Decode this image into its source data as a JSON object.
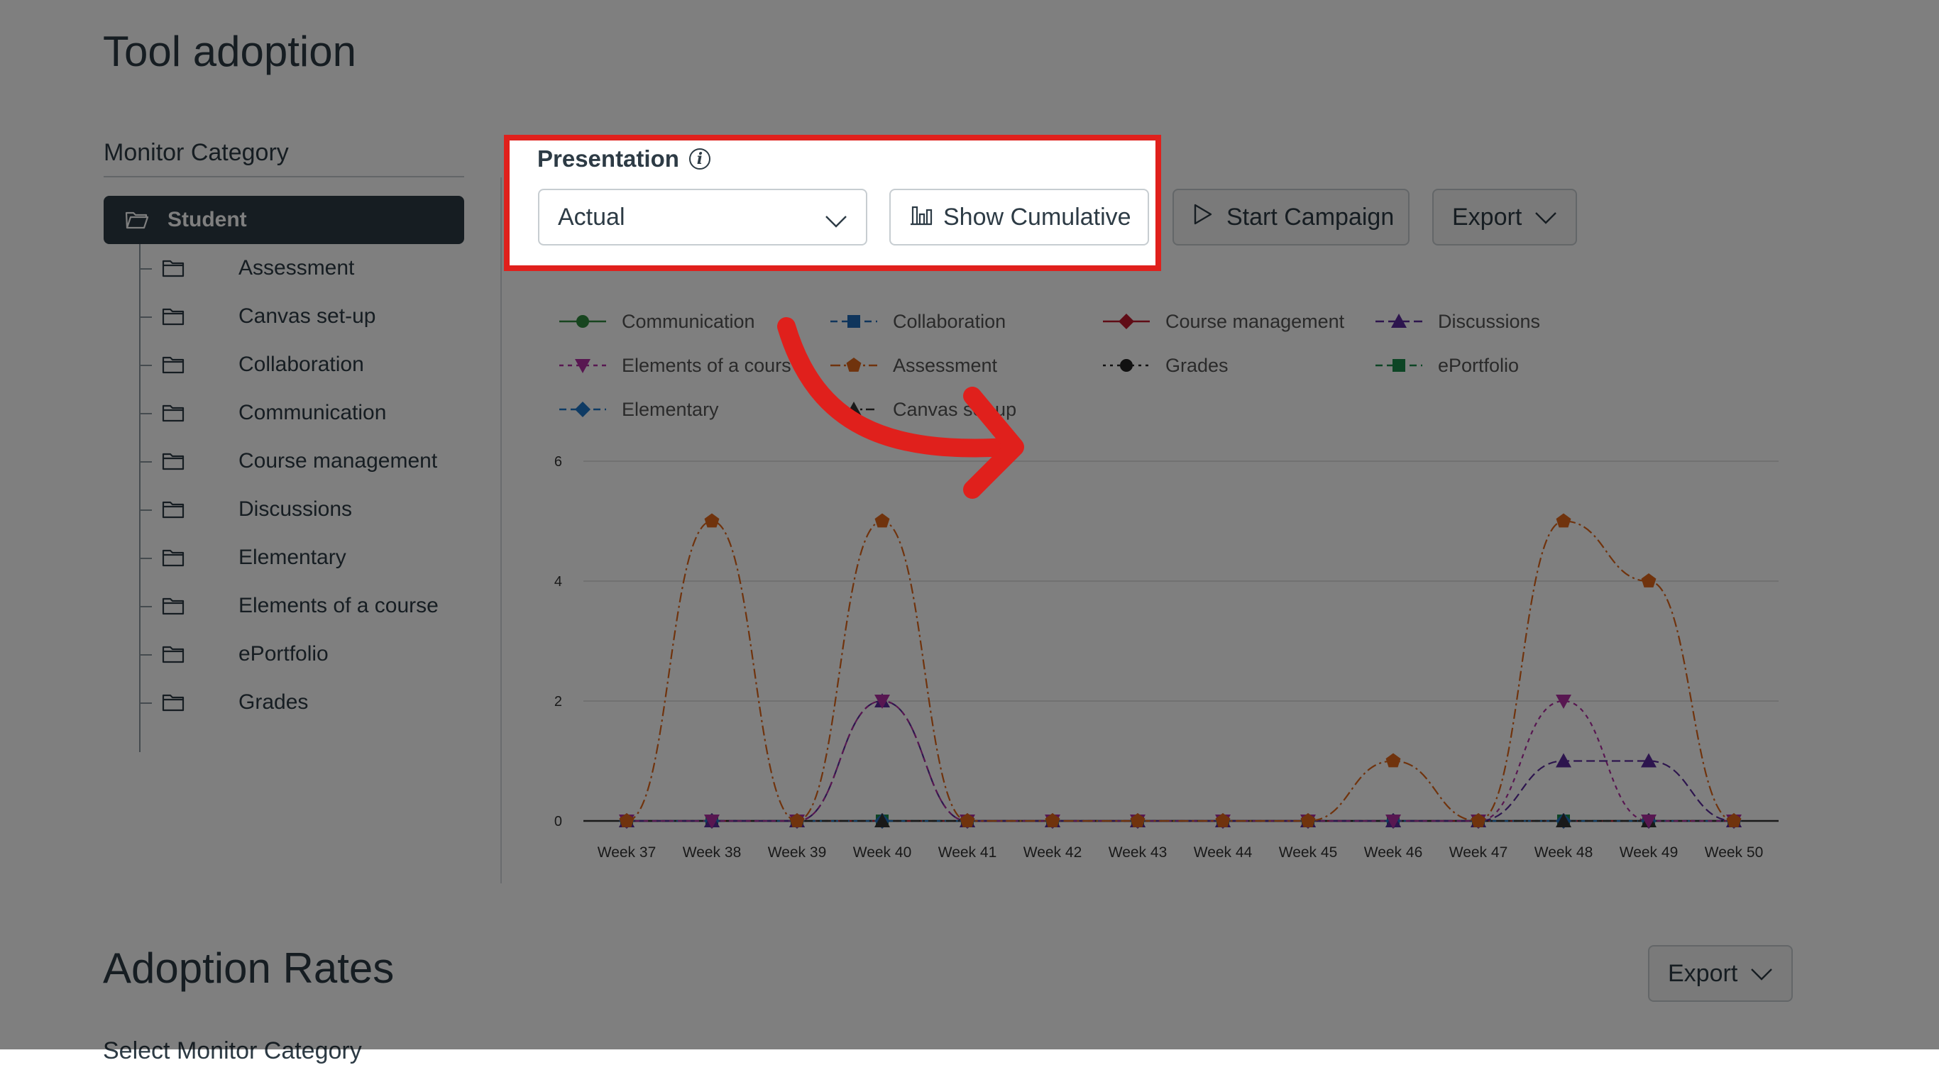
{
  "page": {
    "title": "Tool adoption",
    "section_title": "Adoption Rates",
    "section_subtitle_cut": "Select Monitor Category"
  },
  "sidebar": {
    "label": "Monitor Category",
    "root": "Student",
    "items": [
      {
        "label": "Assessment"
      },
      {
        "label": "Canvas set-up"
      },
      {
        "label": "Collaboration"
      },
      {
        "label": "Communication"
      },
      {
        "label": "Course management"
      },
      {
        "label": "Discussions"
      },
      {
        "label": "Elementary"
      },
      {
        "label": "Elements of a course"
      },
      {
        "label": "ePortfolio"
      },
      {
        "label": "Grades"
      }
    ]
  },
  "toolbar": {
    "presentation_label": "Presentation",
    "presentation_value": "Actual",
    "show_cumulative": "Show Cumulative",
    "start_campaign": "Start Campaign",
    "export": "Export"
  },
  "adoption": {
    "export": "Export"
  },
  "highlight_color": "#e0201c",
  "chart_data": {
    "type": "line",
    "categories": [
      "Week 37",
      "Week 38",
      "Week 39",
      "Week 40",
      "Week 41",
      "Week 42",
      "Week 43",
      "Week 44",
      "Week 45",
      "Week 46",
      "Week 47",
      "Week 48",
      "Week 49",
      "Week 50"
    ],
    "ylim": [
      0,
      6
    ],
    "yticks": [
      0,
      2,
      4,
      6
    ],
    "grid": true,
    "legend_position": "top",
    "series": [
      {
        "name": "Communication",
        "color": "#2e8b3e",
        "marker": "circle",
        "values": [
          0,
          0,
          0,
          0,
          0,
          0,
          0,
          0,
          0,
          0,
          0,
          0,
          0,
          0
        ]
      },
      {
        "name": "Collaboration",
        "color": "#1e6bb8",
        "marker": "square",
        "values": [
          0,
          0,
          0,
          0,
          0,
          0,
          0,
          0,
          0,
          0,
          0,
          0,
          0,
          0
        ]
      },
      {
        "name": "Course management",
        "color": "#c0182c",
        "marker": "diamond",
        "values": [
          0,
          0,
          0,
          0,
          0,
          0,
          0,
          0,
          0,
          0,
          0,
          0,
          0,
          0
        ]
      },
      {
        "name": "Discussions",
        "color": "#5a2a9c",
        "marker": "triangle",
        "values": [
          0,
          0,
          0,
          2,
          0,
          0,
          0,
          0,
          0,
          0,
          0,
          1,
          1,
          0
        ]
      },
      {
        "name": "Elements of a cours",
        "color": "#b02fa2",
        "marker": "triangle-down",
        "values": [
          0,
          0,
          0,
          2,
          0,
          0,
          0,
          0,
          0,
          0,
          0,
          2,
          0,
          0
        ]
      },
      {
        "name": "Assessment",
        "color": "#e0661a",
        "marker": "pentagon",
        "values": [
          0,
          5,
          0,
          5,
          0,
          0,
          0,
          0,
          0,
          1,
          0,
          5,
          4,
          0
        ]
      },
      {
        "name": "Grades",
        "color": "#222222",
        "marker": "circle",
        "values": [
          0,
          0,
          0,
          0,
          0,
          0,
          0,
          0,
          0,
          0,
          0,
          0,
          0,
          0
        ]
      },
      {
        "name": "ePortfolio",
        "color": "#1a8a4a",
        "marker": "square",
        "values": [
          0,
          0,
          0,
          0,
          0,
          0,
          0,
          0,
          0,
          0,
          0,
          0,
          0,
          0
        ]
      },
      {
        "name": "Elementary",
        "color": "#1f77c8",
        "marker": "diamond",
        "values": [
          0,
          0,
          0,
          0,
          0,
          0,
          0,
          0,
          0,
          0,
          0,
          0,
          0,
          0
        ]
      },
      {
        "name": "Canvas set-up",
        "color": "#333333",
        "marker": "triangle",
        "values": [
          0,
          0,
          0,
          0,
          0,
          0,
          0,
          0,
          0,
          0,
          0,
          0,
          0,
          0
        ]
      }
    ]
  }
}
